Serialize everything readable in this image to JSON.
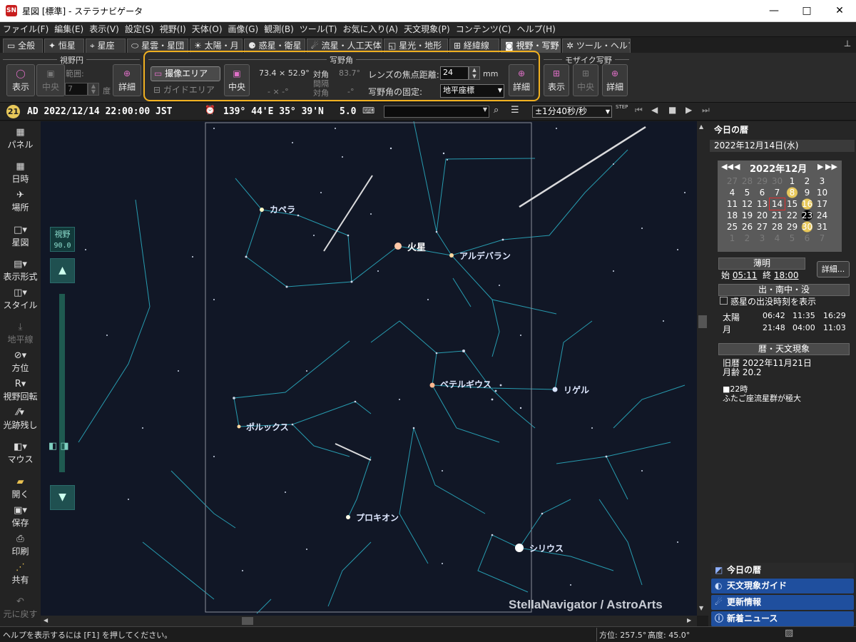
{
  "window": {
    "title": "星図 [標準] - ステラナビゲータ",
    "app_icon_text": "SN"
  },
  "menu": [
    "ファイル(F)",
    "編集(E)",
    "表示(V)",
    "設定(S)",
    "視野(I)",
    "天体(O)",
    "画像(G)",
    "観測(B)",
    "ツール(T)",
    "お気に入り(A)",
    "天文現象(P)",
    "コンテンツ(C)",
    "ヘルプ(H)"
  ],
  "tabs": [
    "全般",
    "恒星",
    "星座",
    "星雲・星団",
    "太陽・月",
    "惑星・衛星",
    "流星・人工天体",
    "星光・地形",
    "経緯線",
    "視野・写野",
    "ツール・ヘルプ"
  ],
  "active_tab": "視野・写野",
  "ribbon": {
    "fov_circle": {
      "title": "視野円",
      "show": "表示",
      "center": "中央",
      "range_label": "範囲:",
      "range_value": "7",
      "unit": "度",
      "detail": "詳細"
    },
    "photo_field": {
      "title": "写野角",
      "capture_area": "撮像エリア",
      "guide_area": "ガイドエリア",
      "center": "中央",
      "size_text": "73.4 × 52.9°",
      "diag_label": "対角",
      "diag_value": "83.7°",
      "interval_label": "間隔",
      "guide_size": "- × -°",
      "guide_diag": "-°",
      "focal_label": "レンズの焦点距離:",
      "focal_value": "24",
      "focal_unit": "mm",
      "fix_label": "写野角の固定:",
      "fix_value": "地平座標",
      "detail": "詳細"
    },
    "mosaic": {
      "title": "モザイク写野",
      "show": "表示",
      "center": "中央",
      "detail": "詳細"
    }
  },
  "infobar": {
    "badge": "21",
    "datetime": "AD 2022/12/14 22:00:00 JST",
    "location": "139° 44'E 35° 39'N",
    "magnitude": "5.0",
    "step": "±1分40秒/秒",
    "step_label": "STEP"
  },
  "leftbar": [
    {
      "label": "パネル",
      "icon": "panel-icon"
    },
    {
      "label": "日時",
      "icon": "calendar-icon"
    },
    {
      "label": "場所",
      "icon": "location-icon"
    },
    {
      "label": "星図",
      "icon": "starmap-icon"
    },
    {
      "label": "表示形式",
      "icon": "display-icon"
    },
    {
      "label": "スタイル",
      "icon": "style-icon"
    },
    {
      "label": "地平線",
      "icon": "horizon-icon"
    },
    {
      "label": "方位",
      "icon": "compass-icon"
    },
    {
      "label": "視野回転",
      "icon": "rotate-icon"
    },
    {
      "label": "光跡残し",
      "icon": "trail-icon"
    },
    {
      "label": "マウス",
      "icon": "mouse-icon"
    },
    {
      "label": "開く",
      "icon": "open-icon"
    },
    {
      "label": "保存",
      "icon": "save-icon"
    },
    {
      "label": "印刷",
      "icon": "print-icon"
    },
    {
      "label": "共有",
      "icon": "share-icon"
    },
    {
      "label": "元に戻す",
      "icon": "undo-icon"
    }
  ],
  "zoom": {
    "label": "視野",
    "value": "90.0"
  },
  "sky_labels": {
    "capella": "カペラ",
    "mars": "火星",
    "aldebaran": "アルデバラン",
    "betelgeuse": "ベテルギウス",
    "rigel": "リゲル",
    "pollux": "ポルックス",
    "procyon": "プロキオン",
    "sirius": "シリウス",
    "watermark": "StellaNavigator / AstroArts"
  },
  "panel": {
    "title": "今日の暦",
    "date": "2022年12月14日(水)",
    "month": "2022年12月",
    "calendar": [
      [
        {
          "d": "27",
          "dim": true
        },
        {
          "d": "28",
          "dim": true
        },
        {
          "d": "29",
          "dim": true
        },
        {
          "d": "30",
          "dim": true
        },
        {
          "d": "1"
        },
        {
          "d": "2"
        },
        {
          "d": "3"
        }
      ],
      [
        {
          "d": "4"
        },
        {
          "d": "5"
        },
        {
          "d": "6"
        },
        {
          "d": "7"
        },
        {
          "d": "8",
          "moon": "full"
        },
        {
          "d": "9"
        },
        {
          "d": "10"
        }
      ],
      [
        {
          "d": "11"
        },
        {
          "d": "12"
        },
        {
          "d": "13"
        },
        {
          "d": "14",
          "today": true
        },
        {
          "d": "15"
        },
        {
          "d": "16",
          "moon": "last"
        },
        {
          "d": "17"
        }
      ],
      [
        {
          "d": "18"
        },
        {
          "d": "19"
        },
        {
          "d": "20"
        },
        {
          "d": "21"
        },
        {
          "d": "22"
        },
        {
          "d": "23",
          "moon": "new"
        },
        {
          "d": "24"
        }
      ],
      [
        {
          "d": "25"
        },
        {
          "d": "26"
        },
        {
          "d": "27"
        },
        {
          "d": "28"
        },
        {
          "d": "29"
        },
        {
          "d": "30",
          "moon": "first"
        },
        {
          "d": "31"
        }
      ],
      [
        {
          "d": "1",
          "dim": true
        },
        {
          "d": "2",
          "dim": true
        },
        {
          "d": "3",
          "dim": true
        },
        {
          "d": "4",
          "dim": true
        },
        {
          "d": "5",
          "dim": true
        },
        {
          "d": "6",
          "dim": true
        },
        {
          "d": "7",
          "dim": true
        }
      ]
    ],
    "twilight": {
      "title": "薄明",
      "start_label": "始",
      "start": "05:11",
      "end_label": "終",
      "end": "18:00",
      "detail": "詳細..."
    },
    "rise_set": {
      "title": "出・南中・没",
      "planet_check": "惑星の出没時刻を表示",
      "sun": [
        "太陽",
        "06:42",
        "11:35",
        "16:29"
      ],
      "moon": [
        "月",
        "21:48",
        "04:00",
        "11:03"
      ]
    },
    "events": {
      "title": "暦・天文現象",
      "lunar_label": "旧暦",
      "lunar": "2022年11月21日",
      "age_label": "月齢",
      "age": "20.2",
      "time": "■22時",
      "desc": "ふたご座流星群が極大"
    },
    "nav": [
      "今日の暦",
      "天文現象ガイド",
      "更新情報",
      "新着ニュース"
    ]
  },
  "status": {
    "help": "ヘルプを表示するには [F1] を押してください。",
    "azimuth": "方位: 257.5°",
    "altitude": "高度: 45.0°"
  },
  "colors": {
    "constellation": "#2bb3c8",
    "highlight": "#f0b020",
    "nav_blue": "#1f4f9e"
  }
}
